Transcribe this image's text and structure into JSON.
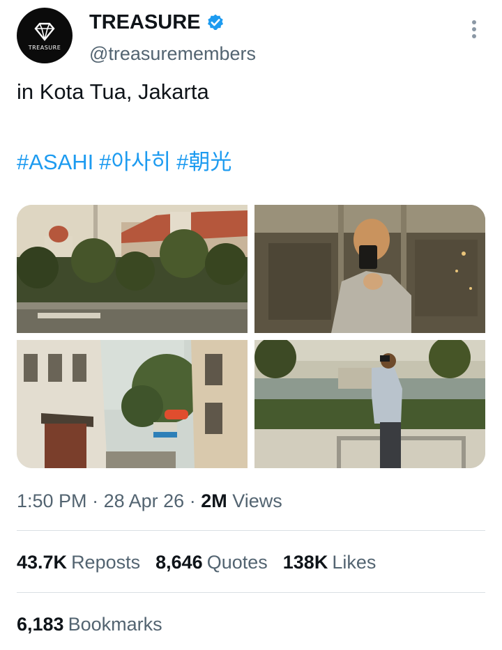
{
  "author": {
    "display_name": "TREASURE",
    "handle": "@treasuremembers",
    "avatar_text": "TREASURE",
    "verified_color": "#1d9bf0"
  },
  "tweet": {
    "text": "in Kota Tua, Jakarta",
    "hashtags": [
      "#ASAHI",
      "#아사히",
      "#朝光"
    ],
    "hashtag_color": "#1d9bf0"
  },
  "media": {
    "photos": [
      {
        "name": "photo-kota-tua-colonial-buildings"
      },
      {
        "name": "photo-mirror-selfie"
      },
      {
        "name": "photo-old-town-street"
      },
      {
        "name": "photo-person-with-camera-riverside"
      }
    ]
  },
  "meta": {
    "time": "1:50 PM",
    "date": "28 Apr 26",
    "views_count": "2M",
    "views_label": "Views"
  },
  "stats": {
    "reposts_count": "43.7K",
    "reposts_label": "Reposts",
    "quotes_count": "8,646",
    "quotes_label": "Quotes",
    "likes_count": "138K",
    "likes_label": "Likes",
    "bookmarks_count": "6,183",
    "bookmarks_label": "Bookmarks"
  },
  "icons": {
    "more": "more-vertical-icon",
    "verified": "verified-badge-icon"
  }
}
